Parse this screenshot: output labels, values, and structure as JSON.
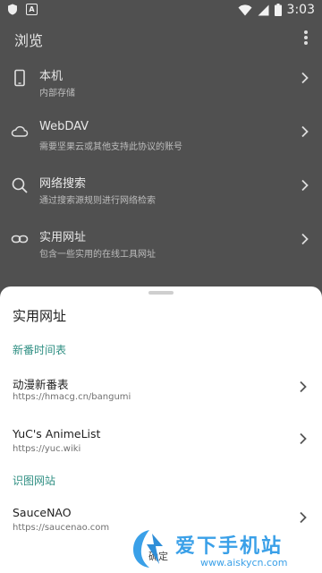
{
  "status_bar": {
    "time": "3:03",
    "left_icons": [
      "shield-icon",
      "a-badge-icon"
    ],
    "right_icons": [
      "wifi-icon",
      "cellular-icon",
      "battery-icon"
    ]
  },
  "app_bar": {
    "title": "浏览",
    "overflow_icon": "more-vert-icon"
  },
  "menu": {
    "items": [
      {
        "title": "本机",
        "subtitle": "内部存储",
        "icon": "phone-icon"
      },
      {
        "title": "WebDAV",
        "subtitle": "需要坚果云或其他支持此协议的账号",
        "icon": "cloud-icon"
      },
      {
        "title": "网络搜索",
        "subtitle": "通过搜索源规则进行网络检索",
        "icon": "search-icon"
      },
      {
        "title": "实用网址",
        "subtitle": "包含一些实用的在线工具网址",
        "icon": "link-icon"
      }
    ]
  },
  "sheet": {
    "title": "实用网址",
    "sections": [
      {
        "header": "新番时间表",
        "links": [
          {
            "title": "动漫新番表",
            "url": "https://hmacg.cn/bangumi"
          },
          {
            "title": "YuC's AnimeList",
            "url": "https://yuc.wiki"
          }
        ]
      },
      {
        "header": "识图网站",
        "links": [
          {
            "title": "SauceNAO",
            "url": "https://saucenao.com"
          }
        ]
      }
    ],
    "confirm_label": "确定"
  },
  "watermark": {
    "brand": "爱下手机站",
    "url": "www.aiskycn.com"
  },
  "colors": {
    "accent": "#2f8f83",
    "backdrop": "#505050",
    "sheet": "#ffffff"
  }
}
